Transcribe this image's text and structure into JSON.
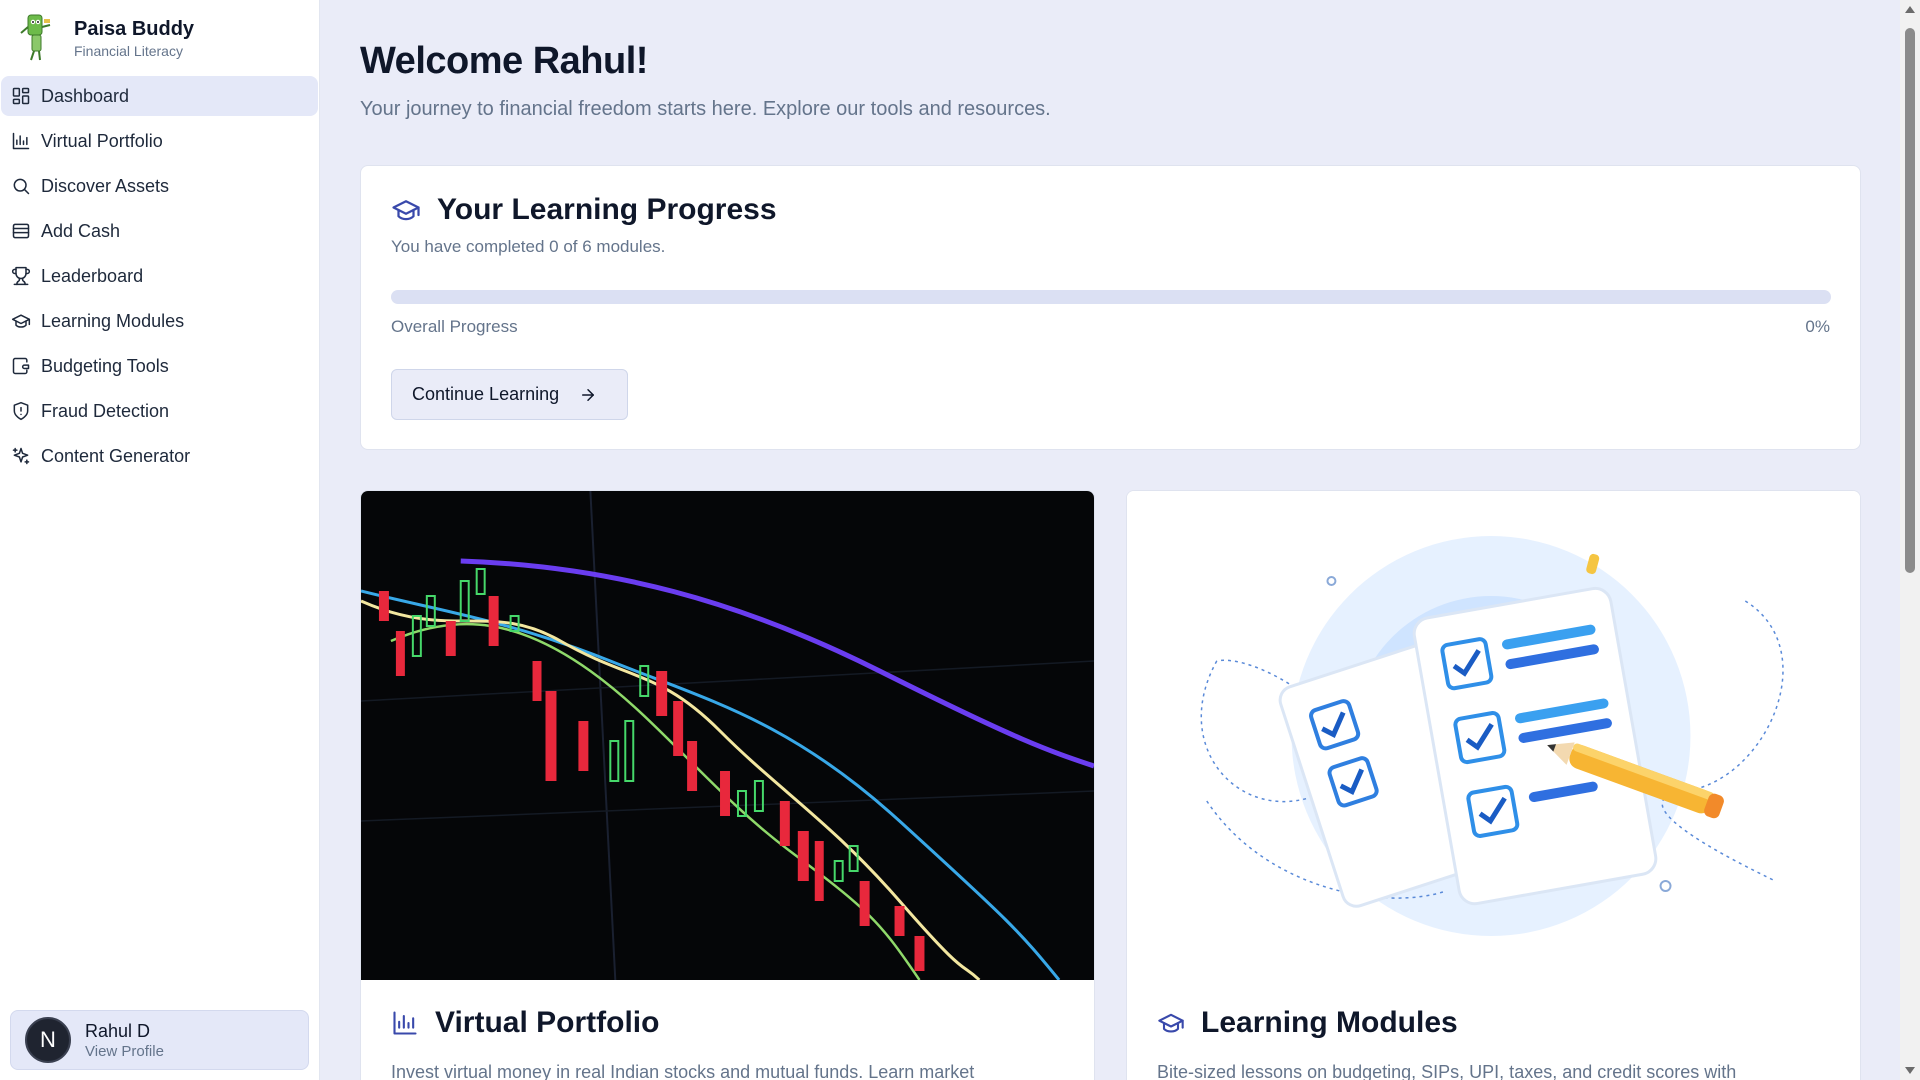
{
  "brand": {
    "title": "Paisa Buddy",
    "subtitle": "Financial Literacy"
  },
  "nav": {
    "items": [
      {
        "label": "Dashboard",
        "icon": "dashboard-grid-icon",
        "active": true
      },
      {
        "label": "Virtual Portfolio",
        "icon": "bar-chart-icon"
      },
      {
        "label": "Discover Assets",
        "icon": "search-icon"
      },
      {
        "label": "Add Cash",
        "icon": "wallet-icon"
      },
      {
        "label": "Leaderboard",
        "icon": "trophy-icon"
      },
      {
        "label": "Learning Modules",
        "icon": "graduation-cap-icon"
      },
      {
        "label": "Budgeting Tools",
        "icon": "budget-wallet-icon"
      },
      {
        "label": "Fraud Detection",
        "icon": "shield-icon"
      },
      {
        "label": "Content Generator",
        "icon": "sparkles-icon"
      }
    ]
  },
  "profile": {
    "initial": "N",
    "name": "Rahul D",
    "link": "View Profile"
  },
  "header": {
    "welcome": "Welcome Rahul!",
    "tagline": "Your journey to financial freedom starts here. Explore our tools and resources."
  },
  "progress": {
    "title": "Your Learning Progress",
    "subtitle": "You have completed 0 of 6 modules.",
    "label": "Overall Progress",
    "value_text": "0%",
    "fraction": 0,
    "cta_label": "Continue Learning"
  },
  "features": [
    {
      "title": "Virtual Portfolio",
      "description": "Invest virtual money in real Indian stocks and mutual funds. Learn market"
    },
    {
      "title": "Learning Modules",
      "description": "Bite-sized lessons on budgeting, SIPs, UPI, taxes, and credit scores with"
    }
  ],
  "colors": {
    "accent": "#3949ab",
    "background": "#eaecf8",
    "muted_text": "#64748b"
  }
}
